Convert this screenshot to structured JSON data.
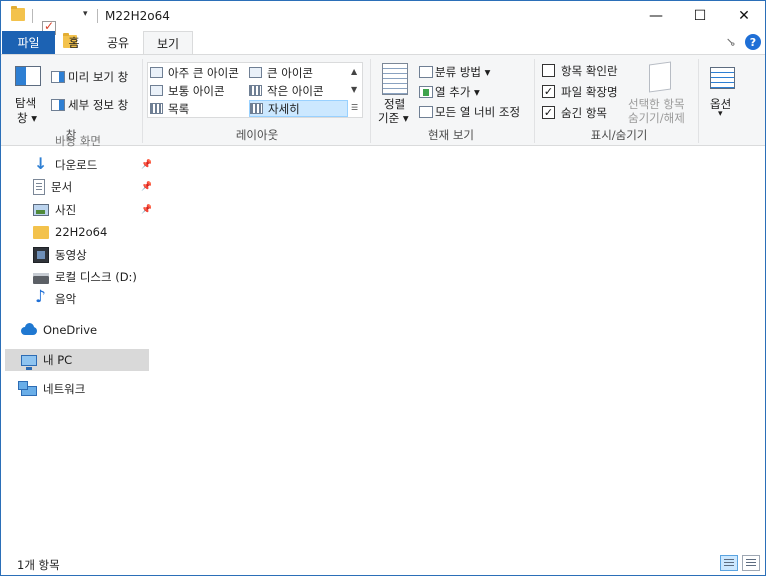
{
  "window": {
    "title": "M22H2o64",
    "controls": {
      "minimize": "—",
      "maximize": "☐",
      "close": "✕"
    }
  },
  "ribbon_tabs": [
    "파일",
    "홈",
    "공유",
    "보기"
  ],
  "active_tab": "보기",
  "ribbon": {
    "panes": {
      "nav_pane_label_1": "탐색",
      "nav_pane_label_2": "창 ▾",
      "preview_pane": "미리 보기 창",
      "details_pane": "세부 정보 창",
      "group_label": "창"
    },
    "layout": {
      "items": [
        "아주 큰 아이콘",
        "큰 아이콘",
        "보통 아이콘",
        "작은 아이콘",
        "목록",
        "자세히"
      ],
      "selected": "자세히",
      "group_label": "레이아웃"
    },
    "current_view": {
      "sort_label_1": "정렬",
      "sort_label_2": "기준 ▾",
      "group_by": "분류 방법 ▾",
      "add_columns": "열 추가 ▾",
      "size_all_columns": "모든 열 너비 조정",
      "group_label": "현재 보기"
    },
    "show_hide": {
      "item_checkboxes": {
        "label": "항목 확인란",
        "checked": false
      },
      "file_extensions": {
        "label": "파일 확장명",
        "checked": true
      },
      "hidden_items": {
        "label": "숨긴 항목",
        "checked": true
      },
      "hide_selected_1": "선택한 항목",
      "hide_selected_2": "숨기기/해제",
      "group_label": "표시/숨기기"
    },
    "options": {
      "label": "옵션",
      "arrow": "▾"
    }
  },
  "nav_pane": {
    "partial_top": "바탕 화면",
    "items": [
      {
        "label": "다운로드",
        "icon": "downloads-icon",
        "pinned": true
      },
      {
        "label": "문서",
        "icon": "documents-icon",
        "pinned": true
      },
      {
        "label": "사진",
        "icon": "pictures-icon",
        "pinned": true
      },
      {
        "label": "22H2o64",
        "icon": "folder-icon",
        "pinned": false
      },
      {
        "label": "동영상",
        "icon": "videos-icon",
        "pinned": false
      },
      {
        "label": "로컬 디스크 (D:)",
        "icon": "drive-icon",
        "pinned": false
      },
      {
        "label": "음악",
        "icon": "music-icon",
        "pinned": false
      }
    ],
    "onedrive": "OneDrive",
    "this_pc": "내 PC",
    "network": "네트워크",
    "selected": "내 PC"
  },
  "status": {
    "item_count": "1개 항목"
  },
  "colors": {
    "file_tab": "#1c62b3",
    "selection": "#cce8ff",
    "nav_selected": "#d9d9d9"
  }
}
